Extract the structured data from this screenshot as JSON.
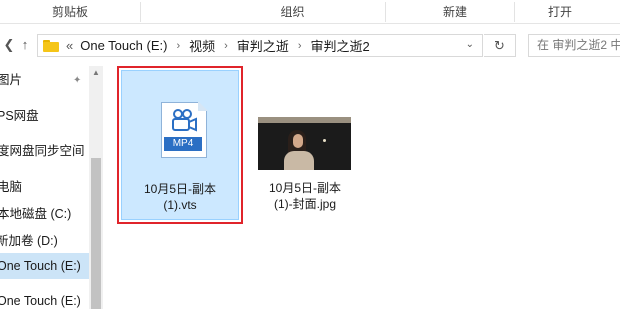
{
  "ribbon": {
    "groups": [
      {
        "label": "剪贴板"
      },
      {
        "label": "组织"
      },
      {
        "label": "新建"
      },
      {
        "label": "打开"
      }
    ]
  },
  "nav": {
    "back_icon": "back-arrow-icon",
    "up_icon": "up-arrow-icon",
    "address": {
      "prefix": "«",
      "crumbs": [
        "One Touch (E:)",
        "视频",
        "审判之逝",
        "审判之逝2"
      ],
      "separator": "›"
    },
    "refresh_icon": "refresh-icon",
    "search_placeholder": "在 审判之逝2 中"
  },
  "sidebar": {
    "items": [
      {
        "label": "图片",
        "pinned": true
      },
      {
        "label": "PS网盘"
      },
      {
        "label": "度网盘同步空间"
      },
      {
        "label": "电脑"
      },
      {
        "label": "本地磁盘 (C:)"
      },
      {
        "label": "新加卷 (D:)"
      },
      {
        "label": "One Touch (E:)",
        "selected": true
      },
      {
        "label": "One Touch (E:)"
      }
    ]
  },
  "files": [
    {
      "name_line1": "10月5日-副本",
      "name_line2": "(1).vts",
      "type_badge": "MP4",
      "selected": true
    },
    {
      "name_line1": "10月5日-副本",
      "name_line2": "(1)-封面.jpg"
    }
  ],
  "colors": {
    "selection": "#cce8ff",
    "highlight_frame": "#e0242b",
    "mp4_badge": "#2b6fc4"
  }
}
